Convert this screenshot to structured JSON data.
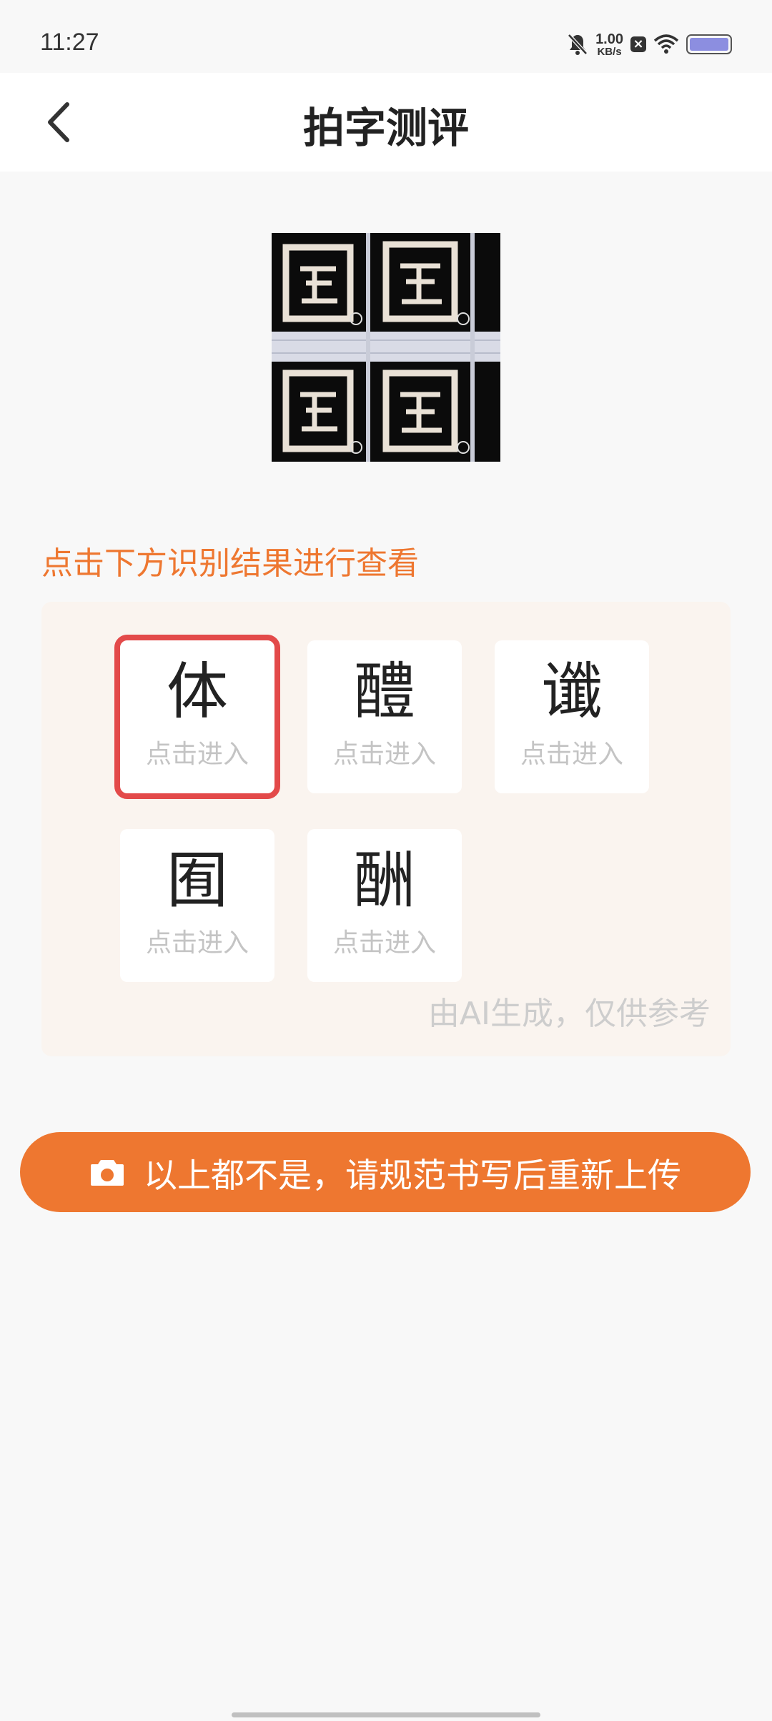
{
  "status_bar": {
    "time": "11:27",
    "net_speed_value": "1.00",
    "net_speed_unit": "KB/s",
    "icons": [
      "bell-muted-icon",
      "close-box-icon",
      "wifi-icon",
      "battery-icon"
    ]
  },
  "nav": {
    "back_icon": "chevron-left-icon",
    "title": "拍字测评"
  },
  "hint": "点击下方识别结果进行查看",
  "results": [
    {
      "char": "体",
      "sub": "点击进入",
      "selected": true
    },
    {
      "char": "醴",
      "sub": "点击进入",
      "selected": false
    },
    {
      "char": "谶",
      "sub": "点击进入",
      "selected": false
    },
    {
      "char": "囿",
      "sub": "点击进入",
      "selected": false
    },
    {
      "char": "酬",
      "sub": "点击进入",
      "selected": false
    }
  ],
  "disclaimer": "由AI生成，仅供参考",
  "reupload_button": {
    "icon": "camera-icon",
    "label": "以上都不是，请规范书写后重新上传"
  },
  "colors": {
    "accent": "#ee7730",
    "selection": "#e34a4a",
    "panel": "#faf4ef"
  }
}
